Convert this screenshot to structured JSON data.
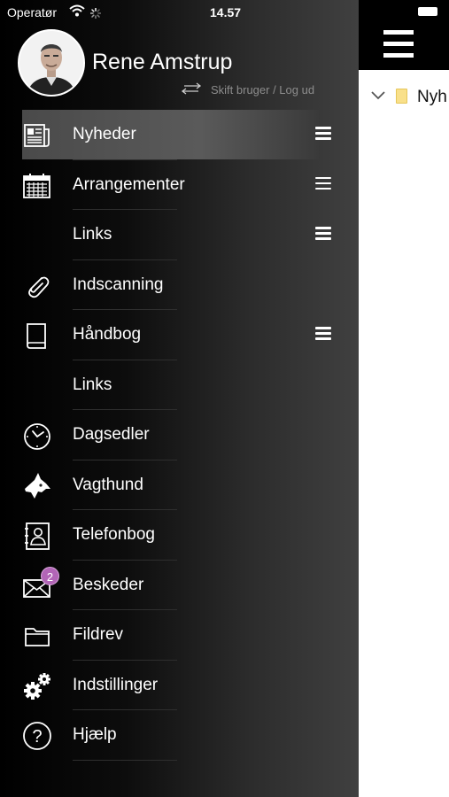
{
  "status_bar": {
    "carrier": "Operatør",
    "time": "14.57"
  },
  "user": {
    "name": "Rene Amstrup",
    "switch_label": "Skift bruger / Log ud"
  },
  "menu": [
    {
      "label": "Nyheder",
      "icon": "newspaper-icon",
      "has_submenu": true,
      "active": true
    },
    {
      "label": "Arrangementer",
      "icon": "calendar-icon",
      "has_submenu": true
    },
    {
      "label": "Links",
      "icon": "",
      "has_submenu": true
    },
    {
      "label": "Indscanning",
      "icon": "paperclip-icon",
      "has_submenu": false
    },
    {
      "label": "Håndbog",
      "icon": "book-icon",
      "has_submenu": true
    },
    {
      "label": "Links",
      "icon": "",
      "has_submenu": false
    },
    {
      "label": "Dagsedler",
      "icon": "clock-icon",
      "has_submenu": false
    },
    {
      "label": "Vagthund",
      "icon": "dog-icon",
      "has_submenu": false
    },
    {
      "label": "Telefonbog",
      "icon": "phonebook-icon",
      "has_submenu": false
    },
    {
      "label": "Beskeder",
      "icon": "envelope-icon",
      "has_submenu": false,
      "badge": "2"
    },
    {
      "label": "Fildrev",
      "icon": "folder-icon",
      "has_submenu": false
    },
    {
      "label": "Indstillinger",
      "icon": "gears-icon",
      "has_submenu": false
    },
    {
      "label": "Hjælp",
      "icon": "help-icon",
      "has_submenu": false
    }
  ],
  "content": {
    "tree_item_label": "Nyh"
  },
  "colors": {
    "badge": "#b265b7",
    "folder": "#f9e08a",
    "topbar": "#000000"
  }
}
